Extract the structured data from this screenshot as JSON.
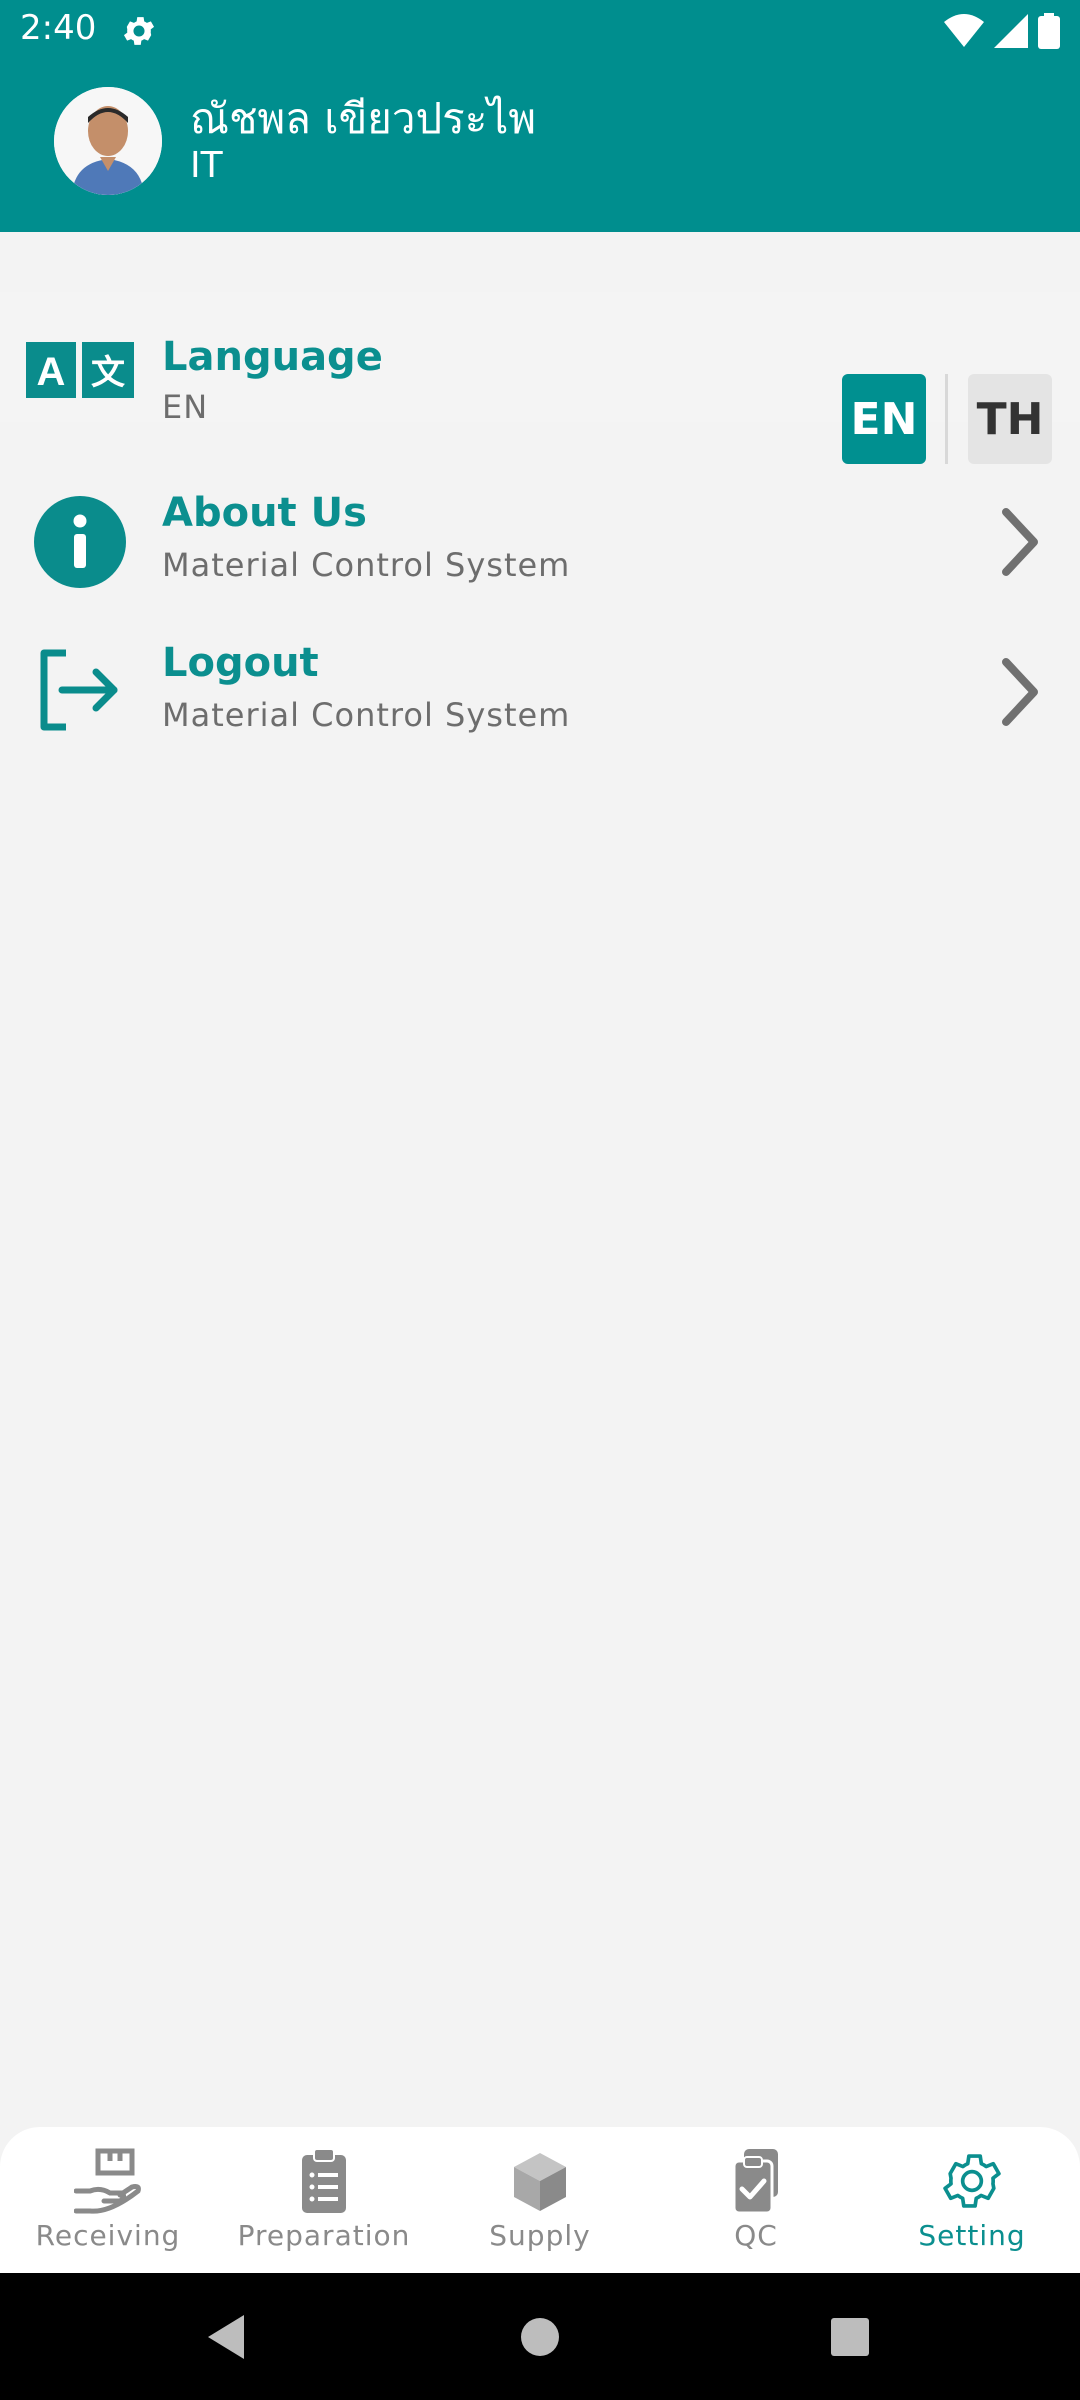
{
  "status_bar": {
    "time": "2:40"
  },
  "profile": {
    "name": "ณัชพล เขียวประไพ",
    "department": "IT"
  },
  "settings": {
    "language": {
      "title": "Language",
      "value": "EN",
      "options": [
        "EN",
        "TH"
      ],
      "selected": "EN"
    },
    "about": {
      "title": "About Us",
      "subtitle": "Material Control System"
    },
    "logout": {
      "title": "Logout",
      "subtitle": "Material Control System"
    }
  },
  "bottom_nav": {
    "items": [
      {
        "label": "Receiving",
        "icon": "receiving-icon"
      },
      {
        "label": "Preparation",
        "icon": "clipboard-list-icon"
      },
      {
        "label": "Supply",
        "icon": "box-icon"
      },
      {
        "label": "QC",
        "icon": "qc-clipboard-check-icon"
      },
      {
        "label": "Setting",
        "icon": "gear-icon"
      }
    ],
    "active": "Setting"
  },
  "colors": {
    "primary": "#008e8e",
    "inactive": "#8a8a8a",
    "background": "#f3f3f3"
  }
}
